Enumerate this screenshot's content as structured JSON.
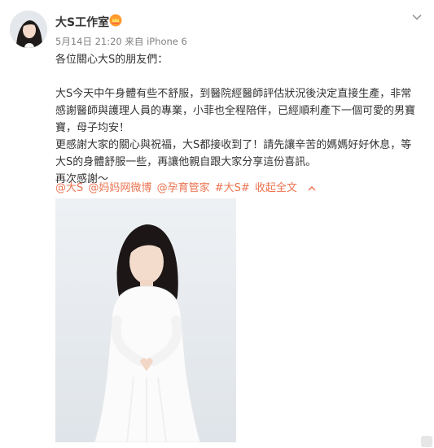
{
  "post": {
    "username": "大S工作室",
    "badge_icon": "vip-crown-icon",
    "date": "5月14日 21:20",
    "source_prefix": "来自",
    "source": "iPhone 6",
    "content_lines": [
      "各位關心大S的朋友們：",
      "",
      "大S今天中午身體有些不舒服，到醫院經醫師評估狀況後決定直接生產，非常",
      "感謝醫師與護理人員的專業，小菲也全程陪伴，已經順利產下一個可愛的男寶",
      "寶，母子均安！",
      "更感謝大家的關心與祝福，大S都接收到了！請先讓辛苦的媽媽好好休息，等",
      "大S的身體舒服一些，再讓他親自跟大家分享這份喜訊。",
      "再次感謝～"
    ],
    "tags": [
      "@大S",
      "@妈妈网微博",
      "@孕育管家",
      "#大S#"
    ],
    "collapse_label": "收起全文",
    "link_color": "#eb7350"
  }
}
